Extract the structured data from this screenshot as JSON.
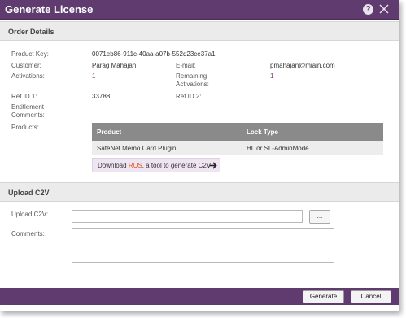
{
  "dialog": {
    "title": "Generate License",
    "help_icon": "?",
    "close_icon_name": "close-icon"
  },
  "order_details": {
    "heading": "Order Details",
    "product_key_label": "Product Key:",
    "product_key_value": "0071eb86-911c-40aa-a07b-552d23ce37a1",
    "customer_label": "Customer:",
    "customer_value": "Parag Mahajan",
    "email_label": "E-mail:",
    "email_value": "pmahajan@miain.com",
    "activations_label": "Activations:",
    "activations_value": "1",
    "remaining_label_line1": "Remaining",
    "remaining_label_line2": "Activations:",
    "remaining_value": "1",
    "ref_id1_label": "Ref ID 1:",
    "ref_id1_value": "33788",
    "ref_id2_label": "Ref ID 2:",
    "ref_id2_value": "",
    "entitlement_label_line1": "Entitlement",
    "entitlement_label_line2": "Comments:",
    "products_label": "Products:",
    "products_table": {
      "columns": [
        "Product",
        "Lock Type"
      ],
      "rows": [
        [
          "SafeNet Memo Card Plugin",
          "HL or SL-AdminMode"
        ]
      ]
    },
    "download": {
      "prefix": "Download ",
      "link": "RUS",
      "suffix": ", a tool to generate C2V"
    }
  },
  "upload_c2v": {
    "heading": "Upload C2V",
    "upload_label": "Upload C2V:",
    "upload_value": "",
    "browse_label": "...",
    "comments_label": "Comments:",
    "comments_value": ""
  },
  "footer": {
    "generate_label": "Generate",
    "cancel_label": "Cancel"
  },
  "colors": {
    "titlebar": "#5f3b6f",
    "link": "#7a2f7a",
    "rus_link": "#e05a1a"
  }
}
